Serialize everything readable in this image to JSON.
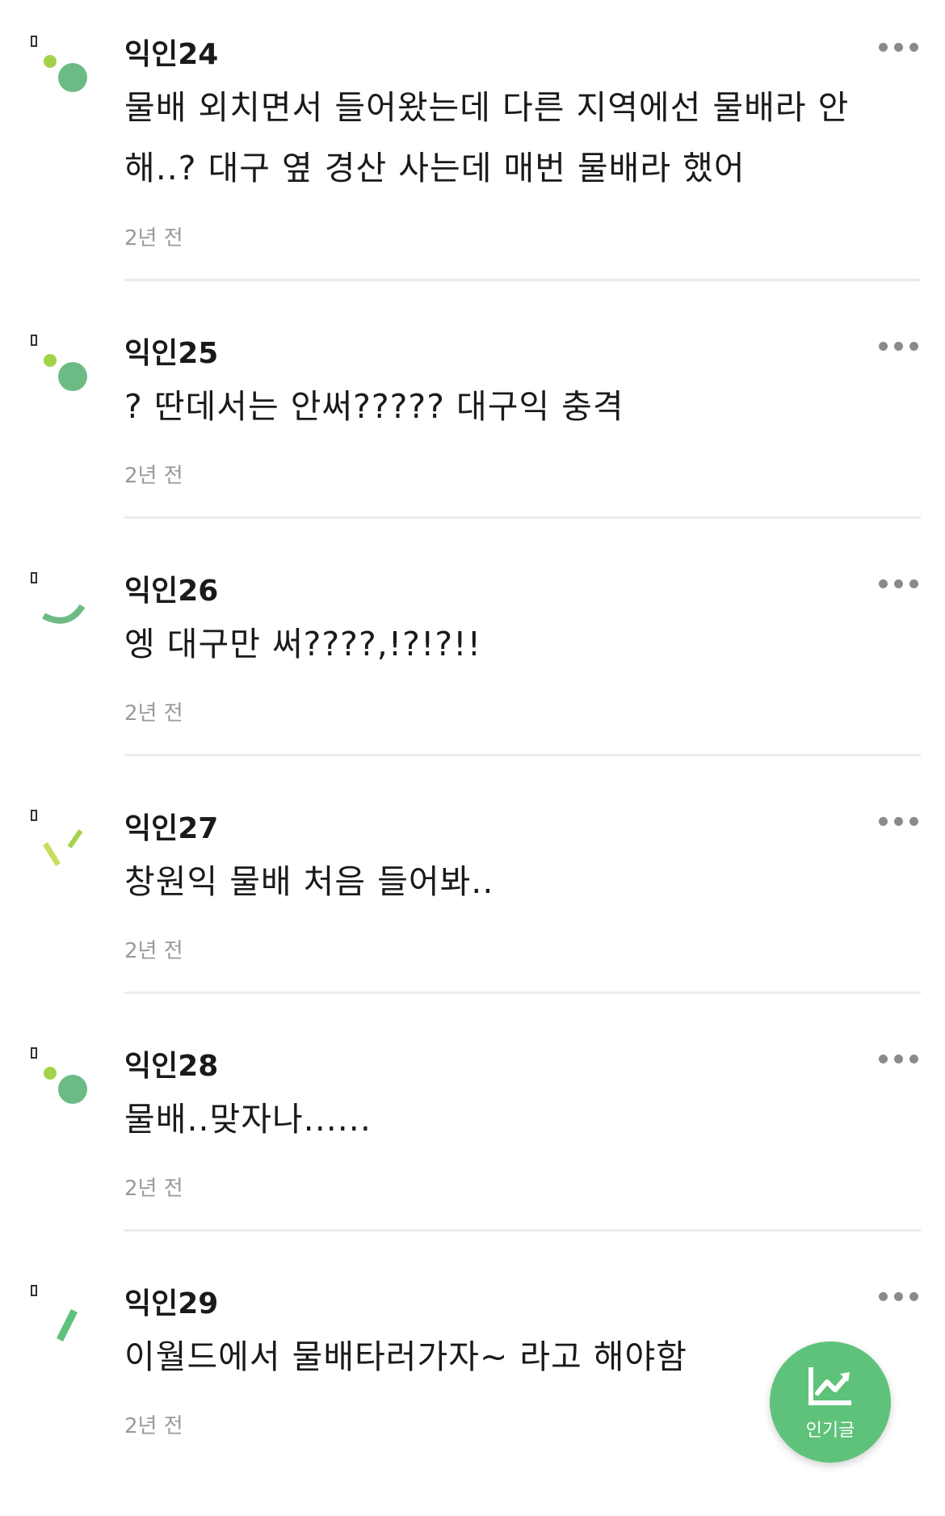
{
  "comments": [
    {
      "nickname": "익인24",
      "body_lines": [
        "물배 외치면서 들어왔는데 다른 지역에선 물배라 안",
        "해..? 대구 옆 경산 사는데 매번 물배라 했어"
      ],
      "time": "2년 전",
      "avatar_icon": "dots-avatar-icon"
    },
    {
      "nickname": "익인25",
      "body_lines": [
        "? 딴데서는 안써????? 대구익 충격"
      ],
      "time": "2년 전",
      "avatar_icon": "dots-avatar-icon"
    },
    {
      "nickname": "익인26",
      "body_lines": [
        "엥 대구만 써????,!?!?!!"
      ],
      "time": "2년 전",
      "avatar_icon": "arc-avatar-icon"
    },
    {
      "nickname": "익인27",
      "body_lines": [
        "창원익 물배 처음 들어봐.."
      ],
      "time": "2년 전",
      "avatar_icon": "lines-avatar-icon"
    },
    {
      "nickname": "익인28",
      "body_lines": [
        "물배..맞자나......"
      ],
      "time": "2년 전",
      "avatar_icon": "dots-avatar-icon"
    },
    {
      "nickname": "익인29",
      "body_lines": [
        "이월드에서 물배타러가자~ 라고 해야함"
      ],
      "time": "2년 전",
      "avatar_icon": "slash-avatar-icon"
    }
  ],
  "fab": {
    "label": "인기글",
    "icon": "trending-chart-icon",
    "color": "#5fc27a"
  },
  "colors": {
    "accent_green": "#6cbb84",
    "lime": "#a4d24a",
    "text": "#1a1a1a",
    "muted": "#9a9a9a"
  }
}
